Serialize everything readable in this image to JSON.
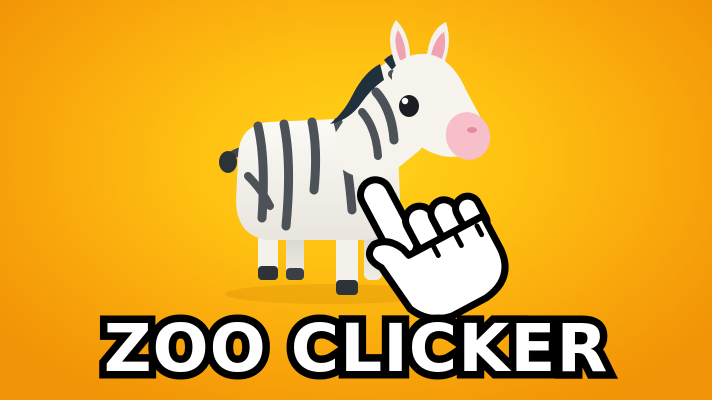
{
  "game": {
    "title": "ZOO CLICKER"
  },
  "colors": {
    "background_center": "#ffd21a",
    "background_edge": "#f29407",
    "zebra_body": "#f4f1ea",
    "zebra_stripe": "#4c5257",
    "zebra_mane": "#20303d",
    "ear_inner": "#f0a2b2",
    "muzzle": "#f6bfc9",
    "title_fill": "#ffffff",
    "title_outline": "#000000"
  },
  "icons": {
    "mascot": "zebra-icon",
    "cursor": "pointing-hand-icon"
  }
}
